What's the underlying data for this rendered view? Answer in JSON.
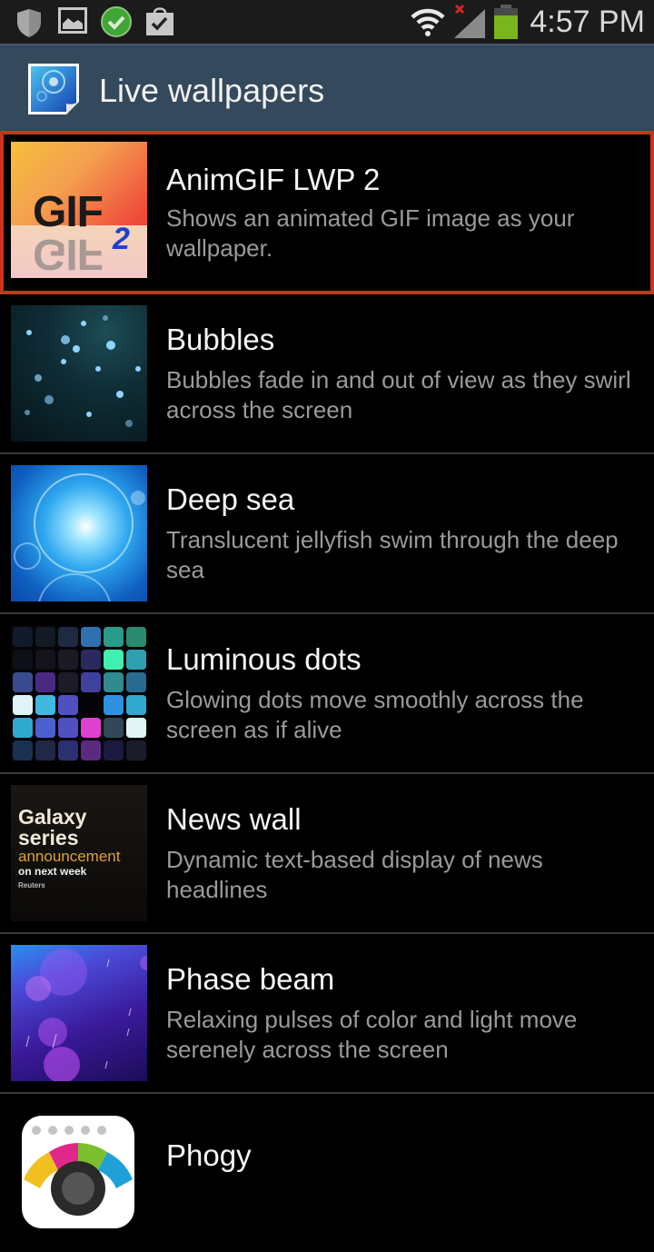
{
  "status_bar": {
    "time": "4:57 PM",
    "left_icons": [
      "shield-icon",
      "image-icon",
      "check-circle-icon",
      "shopping-bag-check-icon"
    ],
    "right_icons": [
      "wifi-icon",
      "signal-no-service-icon",
      "battery-icon"
    ],
    "battery_color": "#7ab51d"
  },
  "action_bar": {
    "title": "Live wallpapers",
    "background": "#34495c"
  },
  "selection_color": "#d0311e",
  "wallpapers": [
    {
      "name": "AnimGIF LWP 2",
      "description": "Shows an animated GIF image as your wallpaper.",
      "selected": true,
      "thumb_text": "GIF",
      "thumb_badge": "2"
    },
    {
      "name": "Bubbles",
      "description": "Bubbles fade in and out of view as they swirl across the screen",
      "selected": false
    },
    {
      "name": "Deep sea",
      "description": "Translucent jellyfish swim through the deep sea",
      "selected": false
    },
    {
      "name": "Luminous dots",
      "description": "Glowing dots move smoothly across the screen as if alive",
      "selected": false
    },
    {
      "name": "News wall",
      "description": "Dynamic text-based display of news headlines",
      "selected": false,
      "thumb_lines": [
        "Galaxy",
        "series",
        "announcement",
        "on next week",
        "Reuters"
      ]
    },
    {
      "name": "Phase beam",
      "description": "Relaxing pulses of color and light move serenely across the screen",
      "selected": false
    },
    {
      "name": "Phogy",
      "description": "",
      "selected": false
    }
  ]
}
